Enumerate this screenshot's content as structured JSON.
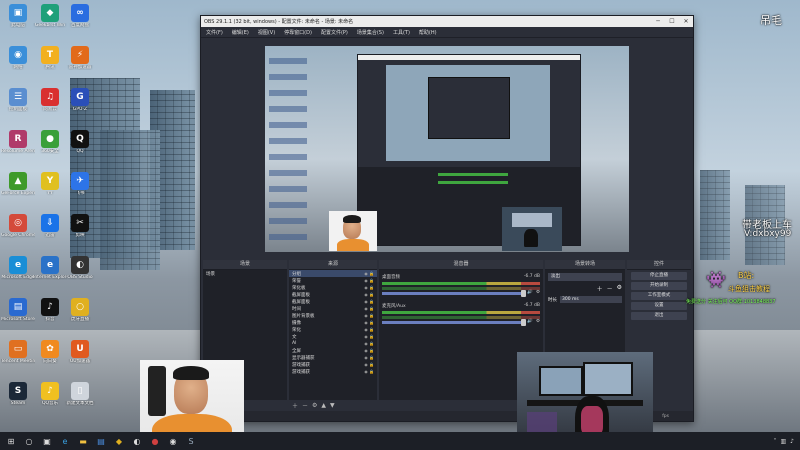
{
  "desktop": {
    "icons": [
      {
        "label": "此电脑",
        "glyph": "▣",
        "color": "#3b8fd9"
      },
      {
        "label": "Geekbrst Win",
        "glyph": "◆",
        "color": "#1fa07a"
      },
      {
        "label": "百度网盘",
        "glyph": "∞",
        "color": "#2a6de0"
      },
      {
        "label": "网络",
        "glyph": "◉",
        "color": "#3b8fd9"
      },
      {
        "label": "腾讯",
        "glyph": "T",
        "color": "#f2b020"
      },
      {
        "label": "雷神加速器",
        "glyph": "⚡",
        "color": "#e26a1a"
      },
      {
        "label": "控制面板",
        "glyph": "☰",
        "color": "#5a8ed0"
      },
      {
        "label": "网易云",
        "glyph": "♫",
        "color": "#d93030"
      },
      {
        "label": "GPU-Z",
        "glyph": "G",
        "color": "#2a4fb8"
      },
      {
        "label": "Resolume Arena",
        "glyph": "R",
        "color": "#b03a6a"
      },
      {
        "label": "360安全",
        "glyph": "●",
        "color": "#3aa03a"
      },
      {
        "label": "QQ",
        "glyph": "Q",
        "color": "#111"
      },
      {
        "label": "GeForce Experience",
        "glyph": "▲",
        "color": "#3e9a2a"
      },
      {
        "label": "YY",
        "glyph": "Y",
        "color": "#e0c020"
      },
      {
        "label": "飞书",
        "glyph": "✈",
        "color": "#2d74e8"
      },
      {
        "label": "Google Chrome",
        "glyph": "◎",
        "color": "#d44a3a"
      },
      {
        "label": "迅雷",
        "glyph": "⇩",
        "color": "#1a73e8"
      },
      {
        "label": "剪映",
        "glyph": "✂",
        "color": "#111"
      },
      {
        "label": "Microsoft Edge",
        "glyph": "e",
        "color": "#1a8ed6"
      },
      {
        "label": "Internet Explorer",
        "glyph": "e",
        "color": "#2a72c8"
      },
      {
        "label": "OBS Studio",
        "glyph": "◐",
        "color": "#333"
      },
      {
        "label": "Microsoft Store",
        "glyph": "▤",
        "color": "#2a6ad0"
      },
      {
        "label": "抖音",
        "glyph": "♪",
        "color": "#111"
      },
      {
        "label": "虎牙直播",
        "glyph": "○",
        "color": "#e0b020"
      },
      {
        "label": "Tencent Meeting",
        "glyph": "▭",
        "color": "#e07020"
      },
      {
        "label": "向日葵",
        "glyph": "✿",
        "color": "#f08a20"
      },
      {
        "label": "UU加速器",
        "glyph": "U",
        "color": "#e05a20"
      },
      {
        "label": "Steam",
        "glyph": "S",
        "color": "#1b2838"
      },
      {
        "label": "QQ音乐",
        "glyph": "♪",
        "color": "#f0c020"
      },
      {
        "label": "新建文本文档",
        "glyph": "▯",
        "color": "#cfd5dc"
      }
    ]
  },
  "obs": {
    "title": "OBS 29.1.1 (32 bit, windows) - 配置文件: 未命名 - 场景: 未命名",
    "menu": [
      "文件(F)",
      "编辑(E)",
      "视图(V)",
      "停靠窗口(D)",
      "配置文件(P)",
      "场景集合(S)",
      "工具(T)",
      "帮助(H)"
    ],
    "docks": {
      "scenes": {
        "title": "场景",
        "items": [
          "场景"
        ]
      },
      "sources": {
        "title": "来源",
        "items": [
          "分组",
          "荣誉",
          "荣化板",
          "截屏面板",
          "截屏面板",
          "时间",
          "图片背景板",
          "摄像",
          "荣化",
          "文",
          "AI",
          "全屏",
          "显示器捕获",
          "游戏捕获",
          "游戏捕获"
        ]
      },
      "mixer": {
        "title": "混音器",
        "channels": [
          {
            "name": "桌面音频",
            "db": "-6.7 dB"
          },
          {
            "name": "麦克风/Aux",
            "db": "-6.7 dB"
          }
        ]
      },
      "transitions": {
        "title": "场景转场",
        "type": "淡出",
        "duration_label": "时长",
        "duration": "300 ms"
      },
      "controls": {
        "title": "控件",
        "buttons": [
          "停止直播",
          "开始录制",
          "工作室模式",
          "设置",
          "退出"
        ]
      }
    },
    "status": "fps"
  },
  "overlay": {
    "name": "吊毛",
    "promo": "带老板上车",
    "wechat": "V:dxbxy99",
    "bilibili": "B站:",
    "tutorial": "斗鱼狙击教程",
    "follow": "免费送分 关注后可 QQ群:1013848837"
  }
}
